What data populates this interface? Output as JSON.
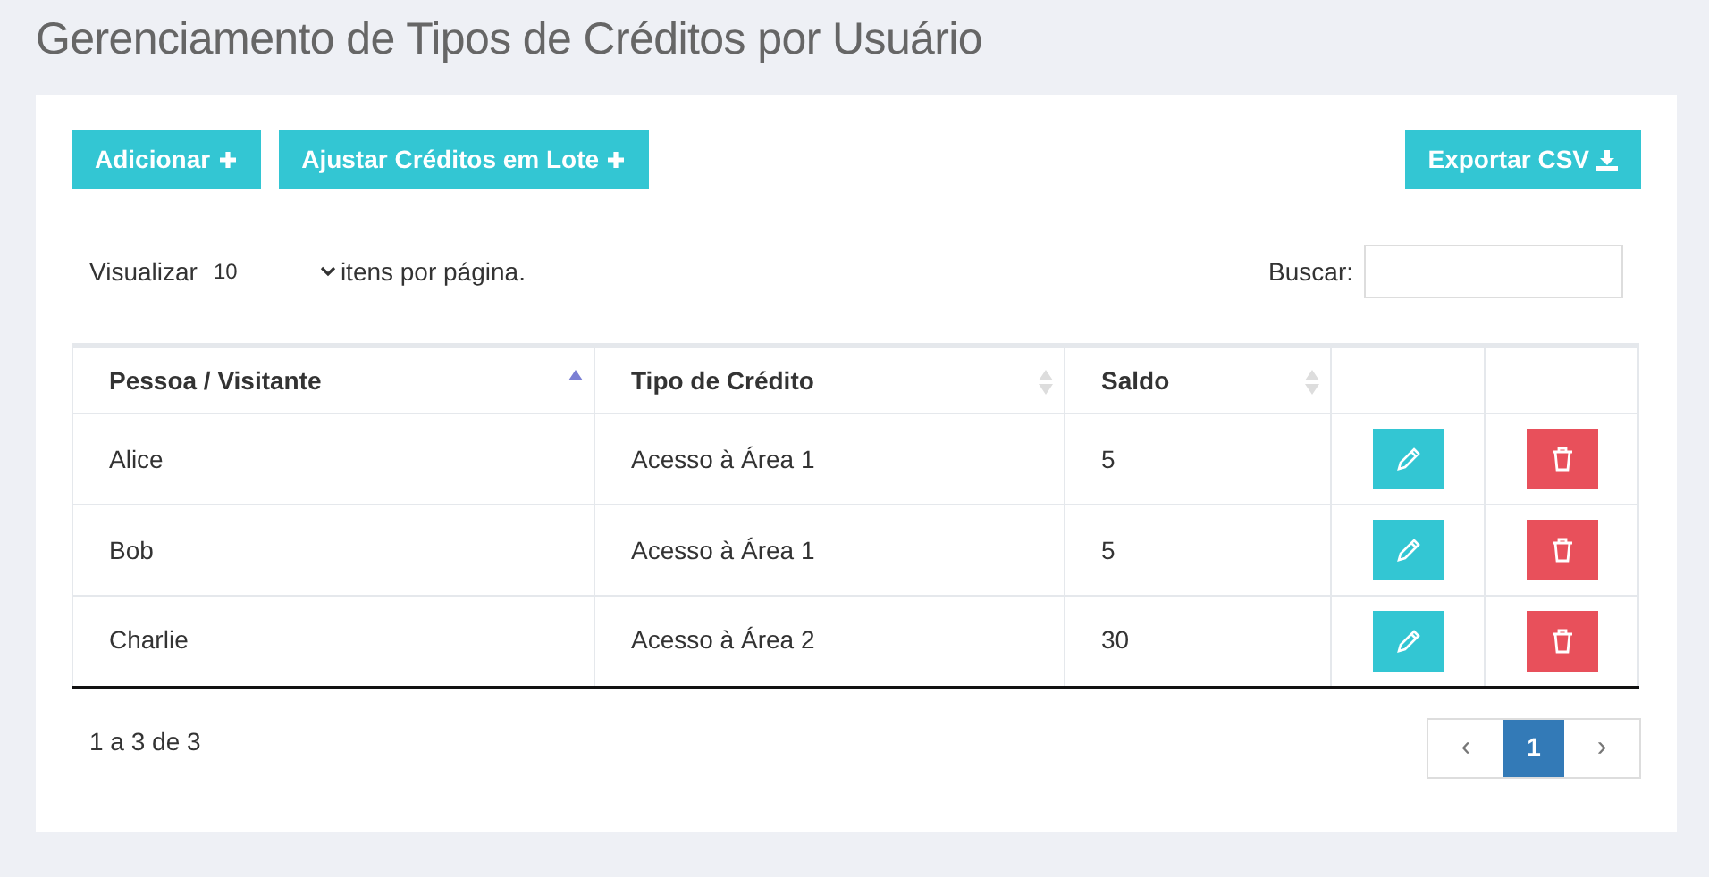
{
  "title": "Gerenciamento de Tipos de Créditos por Usuário",
  "toolbar": {
    "buttons": [
      {
        "label": "Adicionar",
        "kind": "add"
      },
      {
        "label": "Ajustar Créditos em Lote",
        "kind": "add"
      }
    ],
    "export": {
      "label": "Exportar CSV",
      "kind": "download"
    }
  },
  "page_size": {
    "label_before": "Visualizar",
    "value": "10",
    "label_after": "itens por página."
  },
  "search": {
    "label": "Buscar:"
  },
  "table": {
    "columns": [
      {
        "label": "Pessoa / Visitante",
        "kind": "sorted"
      },
      {
        "label": "Tipo de Crédito",
        "kind": "sortable"
      },
      {
        "label": "Saldo",
        "kind": "sortable"
      },
      {
        "kind": "plain"
      },
      {
        "kind": "plain"
      }
    ],
    "rows": [
      {
        "cells": [
          "Alice",
          "Acesso à Área 1",
          "5"
        ]
      },
      {
        "cells": [
          "Bob",
          "Acesso à Área 1",
          "5"
        ]
      },
      {
        "cells": [
          "Charlie",
          "Acesso à Área 2",
          "30"
        ]
      }
    ]
  },
  "summary": "1 a 3 de 3",
  "pagination": {
    "prev": "‹",
    "pages": [
      {
        "label": "1",
        "selected": true
      }
    ],
    "next": "›"
  }
}
